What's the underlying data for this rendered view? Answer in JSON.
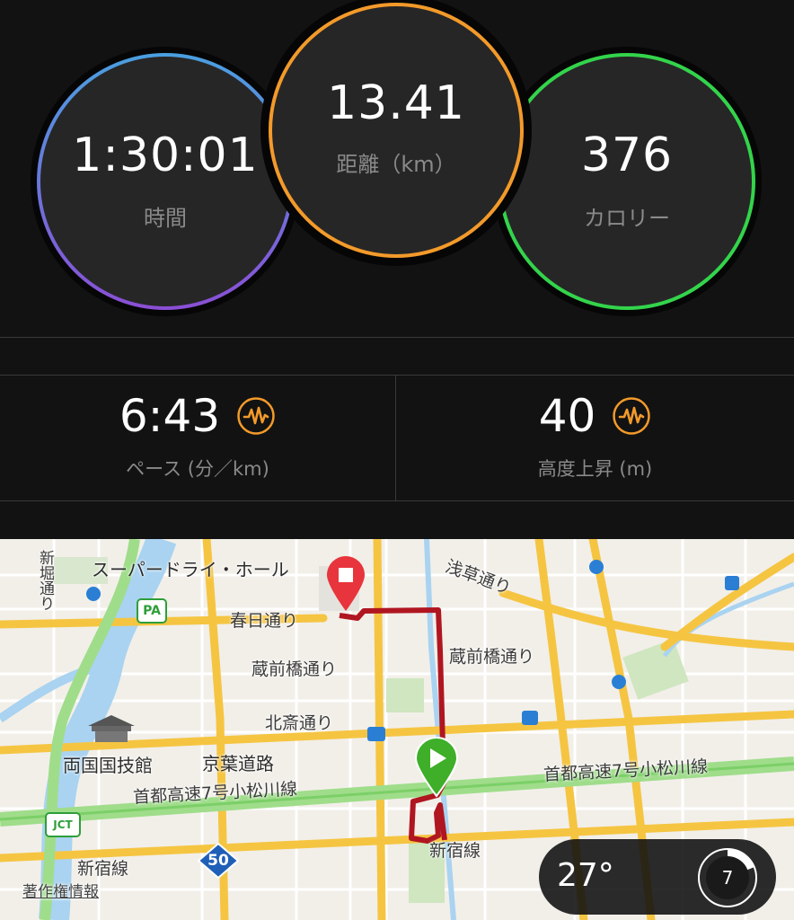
{
  "summary": {
    "time": {
      "value": "1:30:01",
      "label": "時間",
      "color_top": "#4a9fe0",
      "color_bottom": "#8a4fd6"
    },
    "distance": {
      "value": "13.41",
      "label": "距離（km）",
      "color": "#f39a2a"
    },
    "calories": {
      "value": "376",
      "label": "カロリー",
      "color": "#33d44b"
    }
  },
  "stats": {
    "pace": {
      "value": "6:43",
      "label": "ペース (分／km)",
      "icon": "activity-wave-icon"
    },
    "elevation": {
      "value": "40",
      "label": "高度上昇 (m)",
      "icon": "activity-wave-icon"
    }
  },
  "map": {
    "labels": {
      "hall": "スーパードライ・ホール",
      "kasuga": "春日通り",
      "asakusa": "浅草通り",
      "kuramae1": "蔵前橋通り",
      "kuramae2": "蔵前橋通り",
      "hokusai": "北斎通り",
      "keiyo": "京葉道路",
      "kokugikan": "両国国技館",
      "shuto": "首都高速7号小松川線",
      "shuto2": "首都高速7号小松川線",
      "shinjuku1": "新宿線",
      "shinjuku2": "新宿線",
      "shinbori": "新堀通り",
      "pa": "PA",
      "jct": "JCT",
      "route50": "50",
      "copyright": "著作権情報"
    },
    "route_color": "#b01620",
    "start_color": "#3fae29",
    "end_color": "#e8343c"
  },
  "weather": {
    "temp": "27°",
    "wind": "7"
  }
}
